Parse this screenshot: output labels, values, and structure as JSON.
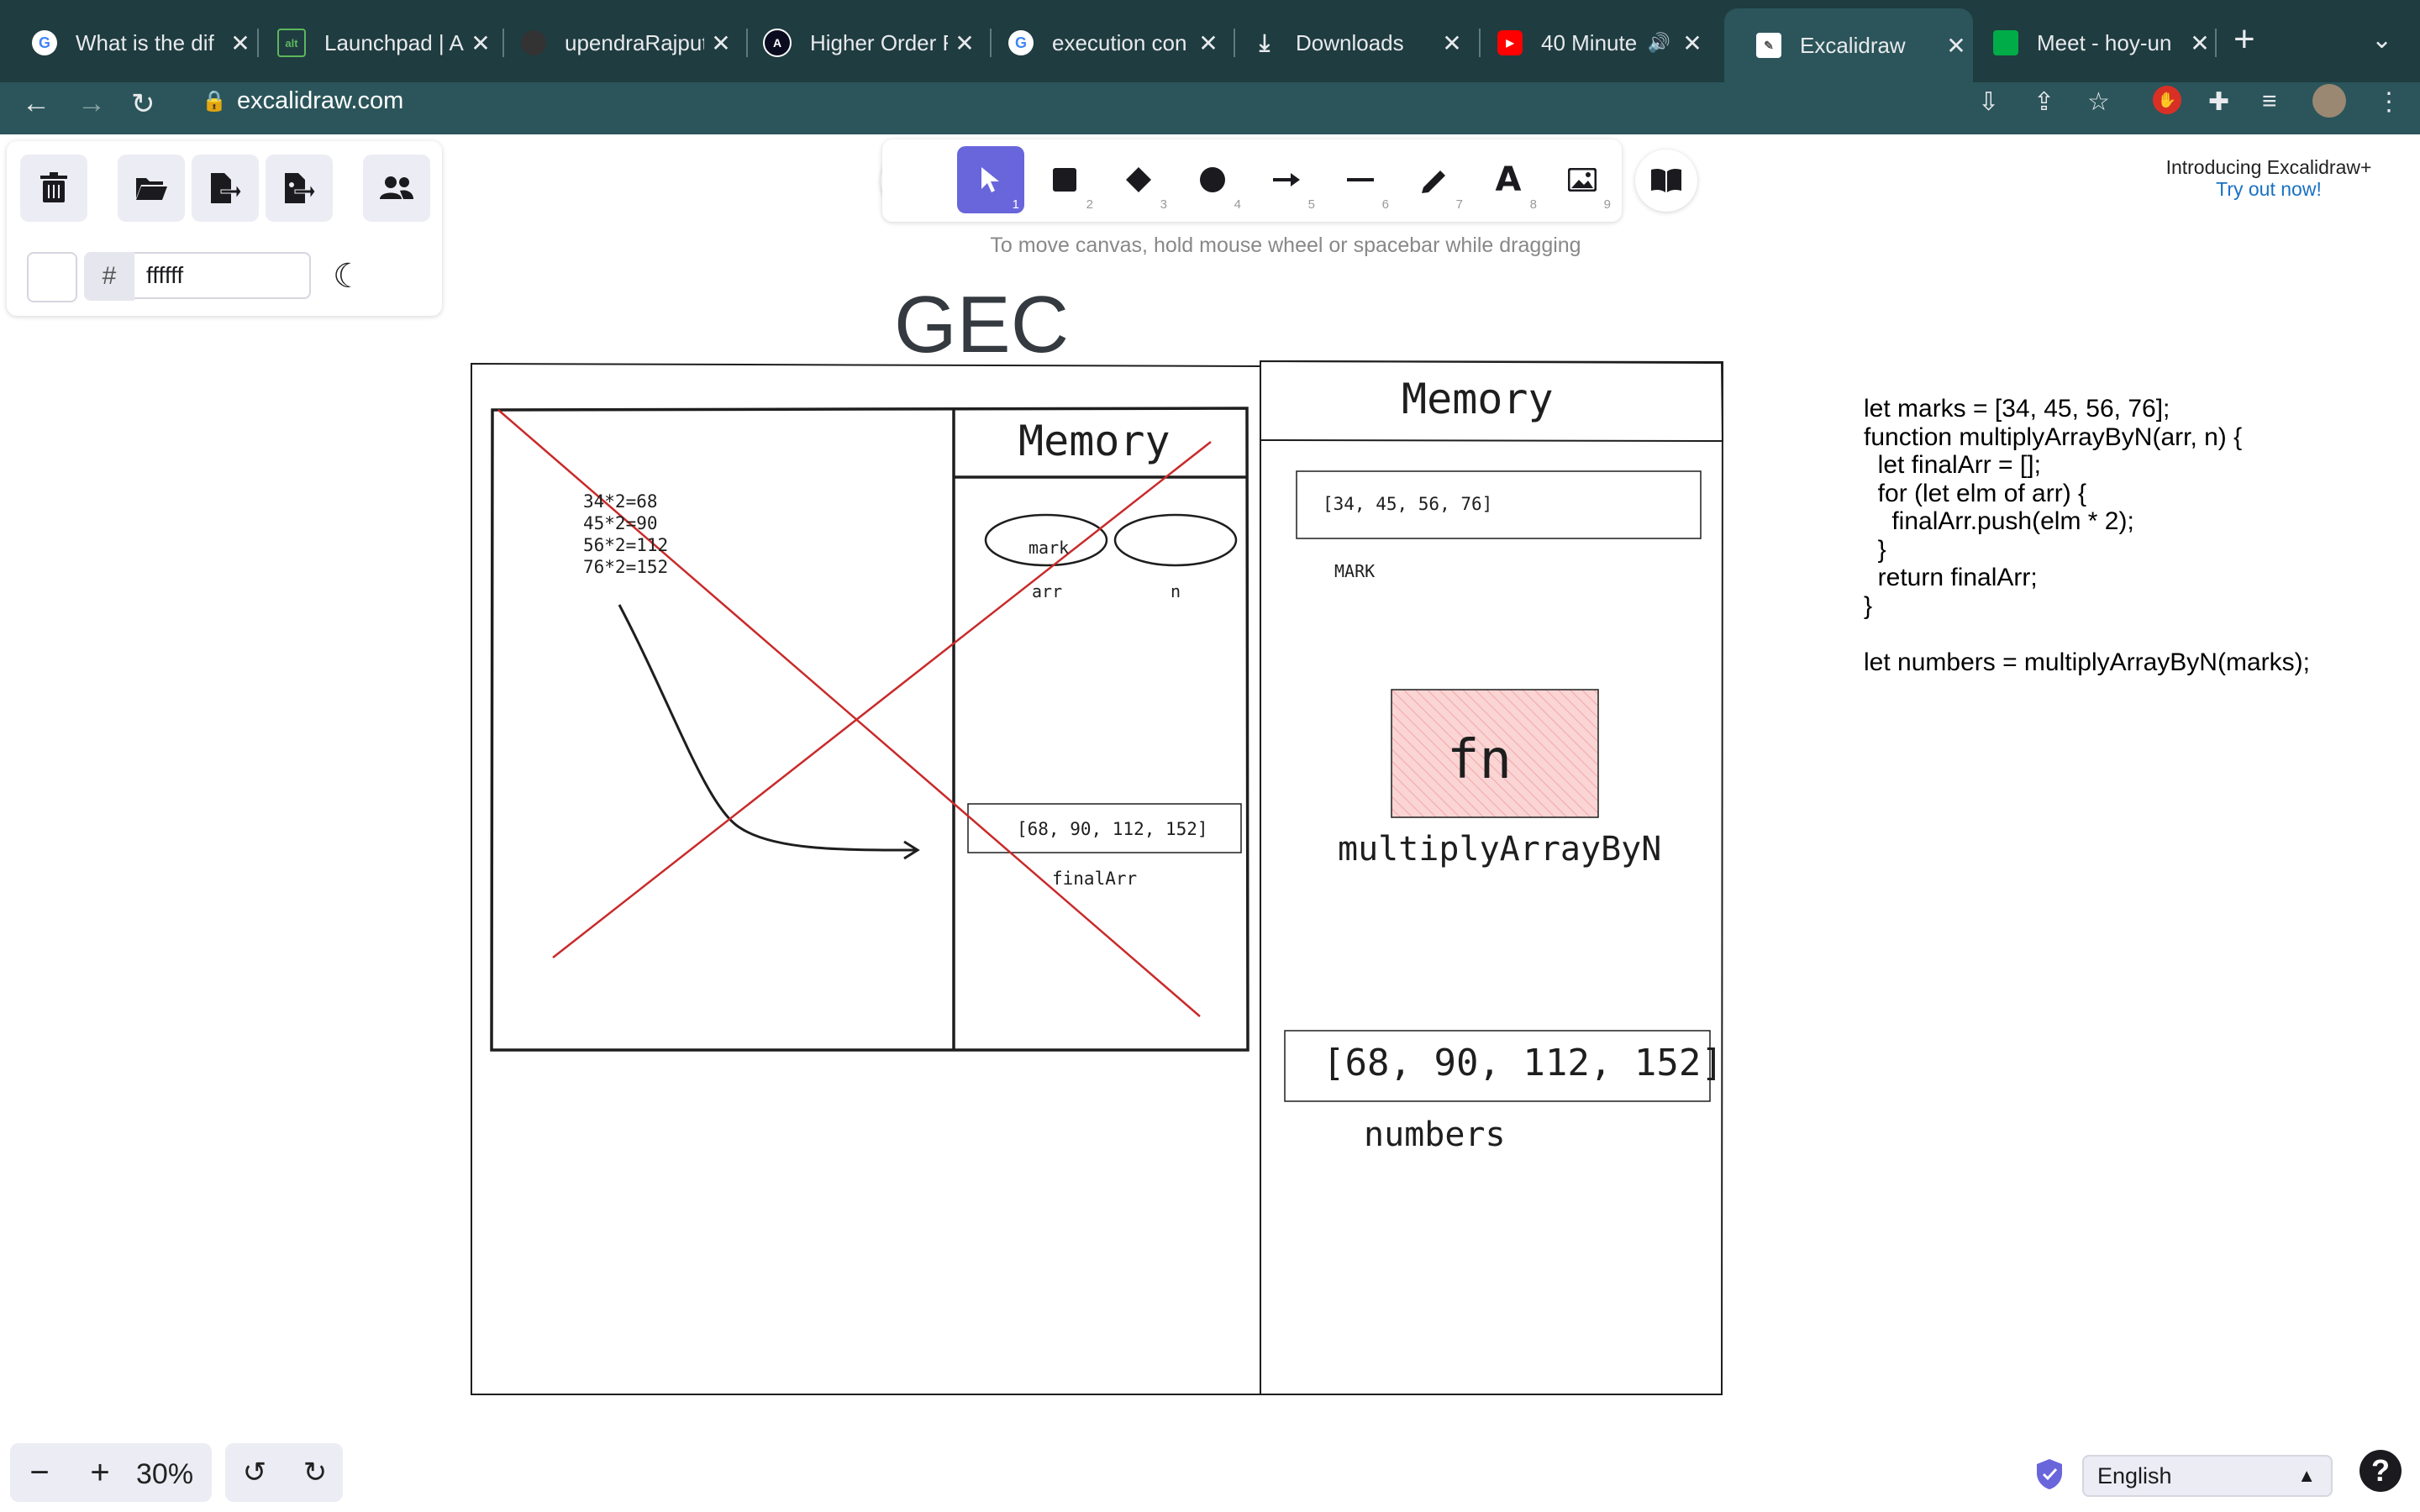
{
  "browser": {
    "tabs": [
      {
        "title": "What is the dif",
        "favicon": "google-icon"
      },
      {
        "title": "Launchpad | A",
        "favicon": "launchpad-icon"
      },
      {
        "title": "upendraRajput",
        "favicon": "github-icon"
      },
      {
        "title": "Higher Order F",
        "favicon": "angular-icon"
      },
      {
        "title": "execution con",
        "favicon": "google-icon"
      },
      {
        "title": "Downloads",
        "favicon": "download-icon"
      },
      {
        "title": "40 Minute",
        "favicon": "youtube-icon"
      },
      {
        "title": "Excalidraw",
        "favicon": "excalidraw-icon",
        "active": true
      },
      {
        "title": "Meet - hoy-un",
        "favicon": "meet-icon"
      }
    ],
    "url": "excalidraw.com"
  },
  "excalidraw": {
    "color_hex": "ffffff",
    "hint": "To move canvas, hold mouse wheel or spacebar while dragging",
    "promo_title": "Introducing Excalidraw+",
    "promo_link": "Try out now!",
    "zoom": "30%",
    "language": "English",
    "tool_numbers": [
      "1",
      "2",
      "3",
      "4",
      "5",
      "6",
      "7",
      "8",
      "9"
    ]
  },
  "canvas": {
    "gec_title": "GEC",
    "left_memory_title": "Memory",
    "calc_lines": [
      "34*2=68",
      "45*2=90",
      "56*2=112",
      "76*2=152"
    ],
    "oval_mark": "mark",
    "label_arr": "arr",
    "label_n": "n",
    "final_array": "[68, 90, 112, 152]",
    "final_label": "finalArr",
    "right_memory_title": "Memory",
    "marks_array": "[34, 45, 56, 76]",
    "marks_label": "MARK",
    "fn_box": "fn",
    "fn_name": "multiplyArrayByN",
    "numbers_array": "[68, 90, 112, 152]",
    "numbers_label": "numbers",
    "code": "let marks = [34, 45, 56, 76];\nfunction multiplyArrayByN(arr, n) {\n  let finalArr = [];\n  for (let elm of arr) {\n    finalArr.push(elm * 2);\n  }\n  return finalArr;\n}\n\nlet numbers = multiplyArrayByN(marks);"
  },
  "colors": {
    "tab_bg": "#1f3c40",
    "toolbar_bg": "#2b555a",
    "selected_tool": "#6965db",
    "cross_red": "#c92a2a",
    "fn_fill": "#ffc9c9"
  }
}
